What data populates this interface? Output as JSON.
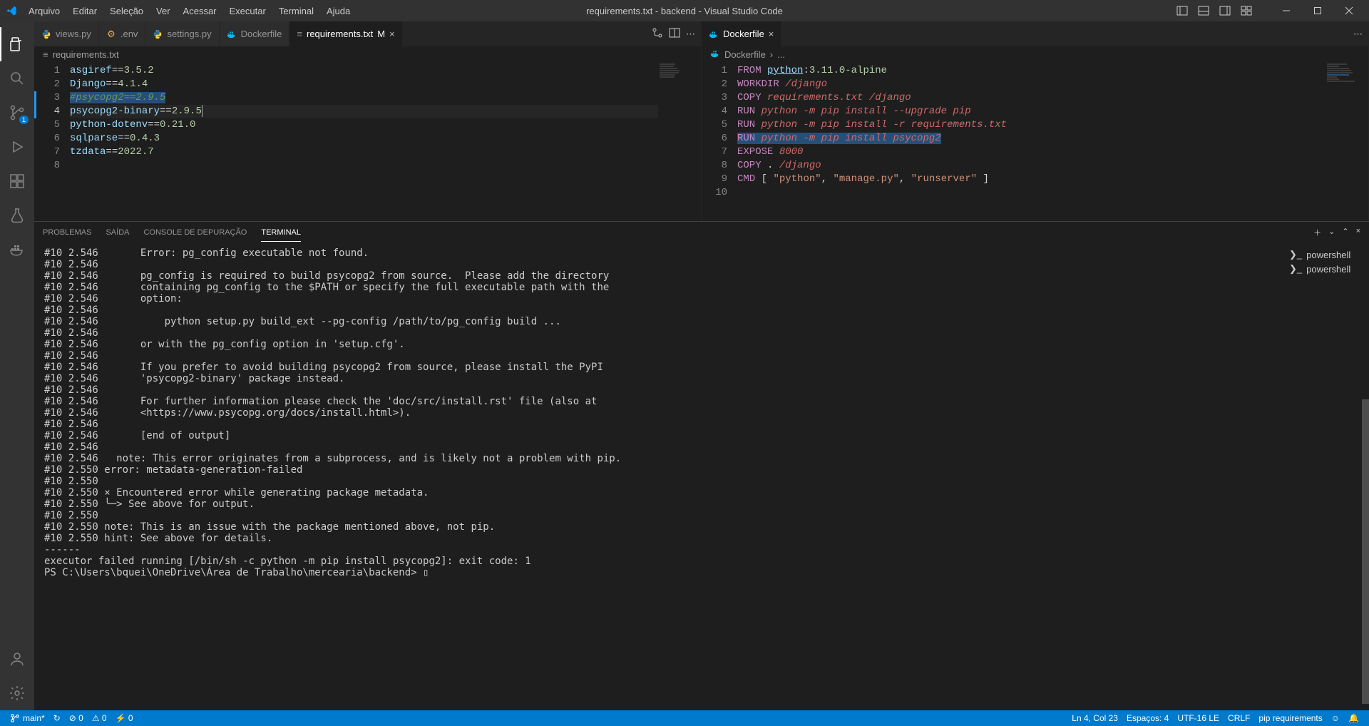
{
  "window_title": "requirements.txt - backend - Visual Studio Code",
  "menus": [
    "Arquivo",
    "Editar",
    "Seleção",
    "Ver",
    "Acessar",
    "Executar",
    "Terminal",
    "Ajuda"
  ],
  "activity": {
    "scm_badge": "1"
  },
  "editor_left": {
    "tabs": [
      {
        "label": "views.py",
        "kind": "python"
      },
      {
        "label": ".env",
        "kind": "env"
      },
      {
        "label": "settings.py",
        "kind": "python"
      },
      {
        "label": "Dockerfile",
        "kind": "docker"
      },
      {
        "label": "requirements.txt",
        "kind": "text",
        "modified": "M",
        "active": true
      }
    ],
    "breadcrumb": "requirements.txt",
    "lines": [
      {
        "n": "1",
        "pkg": "asgiref",
        "op": "==",
        "ver": "3.5.2"
      },
      {
        "n": "2",
        "pkg": "Django",
        "op": "==",
        "ver": "4.1.4"
      },
      {
        "n": "3",
        "comment": "#psycopg2==2.9.5"
      },
      {
        "n": "4",
        "pkg": "psycopg2-binary",
        "op": "==",
        "ver": "2.9.5",
        "active": true
      },
      {
        "n": "5",
        "pkg": "python-dotenv",
        "op": "==",
        "ver": "0.21.0"
      },
      {
        "n": "6",
        "pkg": "sqlparse",
        "op": "==",
        "ver": "0.4.3"
      },
      {
        "n": "7",
        "pkg": "tzdata",
        "op": "==",
        "ver": "2022.7"
      },
      {
        "n": "8"
      }
    ]
  },
  "editor_right": {
    "tabs": [
      {
        "label": "Dockerfile",
        "kind": "docker",
        "active": true
      }
    ],
    "breadcrumb_file": "Dockerfile",
    "breadcrumb_sep": "›",
    "breadcrumb_more": "...",
    "lines": {
      "l1_kw": "FROM",
      "l1_img": "python",
      "l1_colon": ":",
      "l1_tag": "3.11.0-alpine",
      "l2_kw": "WORKDIR",
      "l2_path": "/django",
      "l3_kw": "COPY",
      "l3_a": "requirements.txt",
      "l3_b": "/django",
      "l4_kw": "RUN",
      "l4_cmd": "python -m pip install --upgrade pip",
      "l5_kw": "RUN",
      "l5_cmd": "python -m pip install -r requirements.txt",
      "l6_kw": "RUN",
      "l6_cmd": "python -m pip install psycopg2",
      "l7_kw": "EXPOSE",
      "l7_port": "8000",
      "l8_kw": "COPY",
      "l8_a": ".",
      "l8_b": "/django",
      "l9_kw": "CMD",
      "l9_open": "[ ",
      "l9_a": "\"python\"",
      "l9_c1": ", ",
      "l9_b": "\"manage.py\"",
      "l9_c2": ", ",
      "l9_c": "\"runserver\"",
      "l9_close": " ]"
    },
    "line_nums": [
      "1",
      "2",
      "3",
      "4",
      "5",
      "6",
      "7",
      "8",
      "9",
      "10"
    ]
  },
  "panel": {
    "tabs": [
      "PROBLEMAS",
      "SAÍDA",
      "CONSOLE DE DEPURAÇÃO",
      "TERMINAL"
    ],
    "active_tab": 3,
    "processes": [
      {
        "icon": "ps",
        "label": "powershell"
      },
      {
        "icon": "ps",
        "label": "powershell"
      }
    ],
    "terminal": "#10 2.546       Error: pg_config executable not found.\n#10 2.546\n#10 2.546       pg_config is required to build psycopg2 from source.  Please add the directory\n#10 2.546       containing pg_config to the $PATH or specify the full executable path with the\n#10 2.546       option:\n#10 2.546\n#10 2.546           python setup.py build_ext --pg-config /path/to/pg_config build ...\n#10 2.546\n#10 2.546       or with the pg_config option in 'setup.cfg'.\n#10 2.546\n#10 2.546       If you prefer to avoid building psycopg2 from source, please install the PyPI\n#10 2.546       'psycopg2-binary' package instead.\n#10 2.546\n#10 2.546       For further information please check the 'doc/src/install.rst' file (also at\n#10 2.546       <https://www.psycopg.org/docs/install.html>).\n#10 2.546\n#10 2.546       [end of output]\n#10 2.546\n#10 2.546   note: This error originates from a subprocess, and is likely not a problem with pip.\n#10 2.550 error: metadata-generation-failed\n#10 2.550\n#10 2.550 × Encountered error while generating package metadata.\n#10 2.550 ╰─> See above for output.\n#10 2.550\n#10 2.550 note: This is an issue with the package mentioned above, not pip.\n#10 2.550 hint: See above for details.\n------\nexecutor failed running [/bin/sh -c python -m pip install psycopg2]: exit code: 1\nPS C:\\Users\\bquei\\OneDrive\\Área de Trabalho\\mercearia\\backend> ▯"
  },
  "status": {
    "branch": "main*",
    "sync": "↻",
    "errors": "⊘ 0",
    "warnings": "⚠ 0",
    "ports0": "⚡ 0",
    "ln_col": "Ln 4, Col 23",
    "spaces": "Espaços: 4",
    "encoding": "UTF-16 LE",
    "eol": "CRLF",
    "lang": "pip requirements",
    "feedback": "☺",
    "bell": "🔔"
  }
}
